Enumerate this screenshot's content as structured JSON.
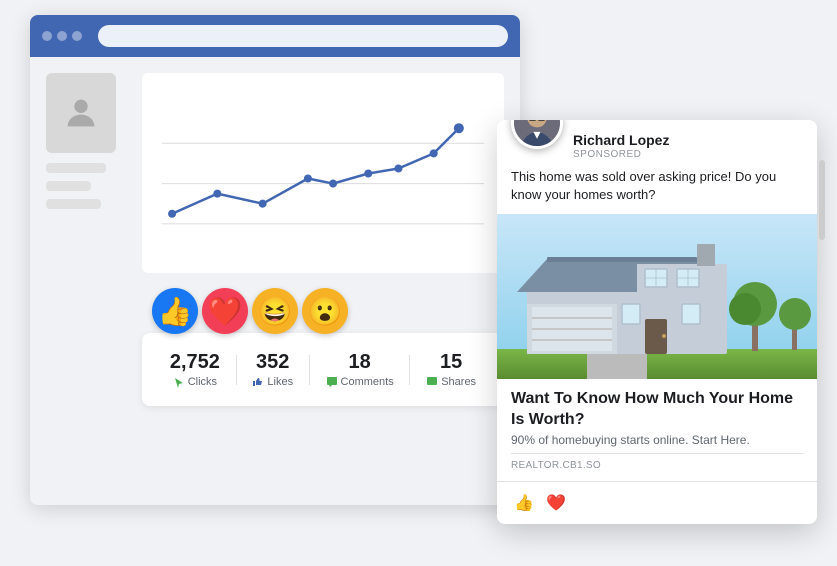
{
  "browser": {
    "dots": [
      "dot1",
      "dot2",
      "dot3"
    ]
  },
  "stats": {
    "clicks_value": "2,752",
    "clicks_label": "Clicks",
    "likes_value": "352",
    "likes_label": "Likes",
    "comments_value": "18",
    "comments_label": "Comments",
    "shares_value": "15",
    "shares_label": "Shares"
  },
  "agent": {
    "name": "Richard Lopez",
    "sponsored": "SPONSORED",
    "post_text": "This home was sold over asking price! Do you know your homes worth?",
    "cta_title": "Want To Know How Much Your Home Is Worth?",
    "cta_subtitle": "90% of homebuying starts online. Start Here.",
    "domain": "REALTOR.CB1.SO"
  }
}
